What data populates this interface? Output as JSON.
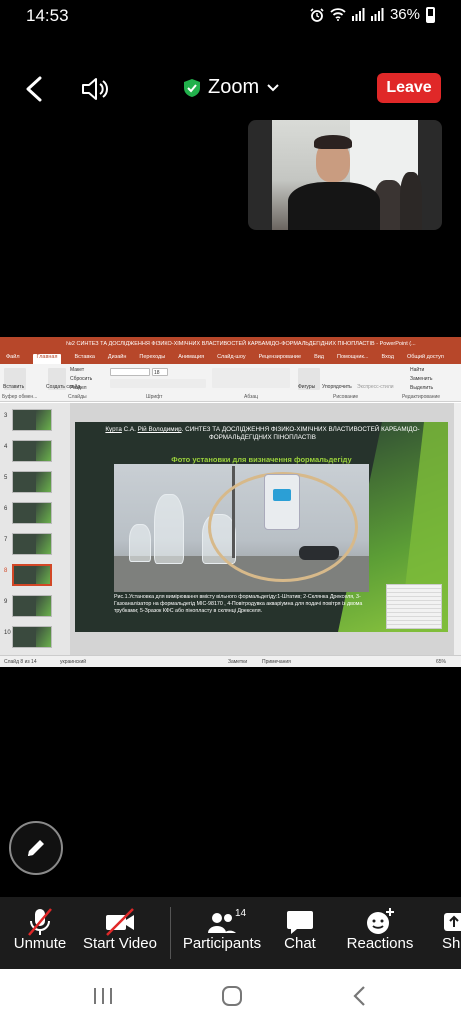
{
  "status_bar": {
    "time": "14:53",
    "battery": "36%"
  },
  "meeting": {
    "app_name": "Zoom",
    "leave_label": "Leave"
  },
  "shared_screen": {
    "window_title": "№2 СИНТЕЗ ТА ДОСЛІДЖЕННЯ ФІЗИКО-ХІМІЧНИХ ВЛАСТИВОСТЕЙ КАРБАМІДО-ФОРМАЛЬДЕГІДНИХ ПІНОПЛАСТІВ - PowerPoint (...",
    "ribbon_tabs": [
      "Файл",
      "Главная",
      "Вставка",
      "Дизайн",
      "Переходы",
      "Анимация",
      "Слайд-шоу",
      "Рецензирование",
      "Вид",
      "Помощник...",
      "Вход",
      "Общий доступ"
    ],
    "active_tab": "Главная",
    "ribbon_groups": [
      "Буфер обмен...",
      "Слайды",
      "Шрифт",
      "Абзац",
      "Рисование",
      "Редактирование"
    ],
    "ribbon_labels": {
      "paste": "Вставить",
      "new_slide": "Создать слайд",
      "layout": "Макет",
      "reset": "Сбросить",
      "section": "Раздел",
      "shapes": "Фигуры",
      "arrange": "Упорядочить",
      "quick_styles": "Экспресс-стили",
      "find": "Найти",
      "replace": "Заменить",
      "select": "Выделить",
      "font_size": "18"
    },
    "thumbnails": [
      {
        "num": "3"
      },
      {
        "num": "4"
      },
      {
        "num": "5"
      },
      {
        "num": "6"
      },
      {
        "num": "7"
      },
      {
        "num": "8"
      },
      {
        "num": "9"
      },
      {
        "num": "10"
      }
    ],
    "slide": {
      "authors_underlined": "Курта",
      "authors_mid": " С.А. ",
      "authors_underlined2": "Рій Володимир",
      "title": ". СИНТЕЗ ТА ДОСЛІДЖЕННЯ ФІЗИКО-ХІМІЧНИХ ВЛАСТИВОСТЕЙ КАРБАМІДО-ФОРМАЛЬДЕГІДНИХ ПІНОПЛАСТІВ",
      "subtitle": "Фото установки для визначення формальдегіду",
      "caption": "Рис.1.Установка для вимірювання вмісту вільного формальдегіду:1-Штатив; 2-Склянка Дрекселя, 3-Газоаналізатор на формальдегід МІС-98170 , 4-Повітродувка акваріумна для подачі повітря із двома трубками; 5-Зразок КФС або пінопласту в склянці Дрекселя."
    },
    "statusbar": {
      "slide_info": "Слайд 8 из 14",
      "language": "украинский",
      "notes": "Заметки",
      "comments": "Примечания",
      "zoom": "65%"
    }
  },
  "toolbar": {
    "unmute": "Unmute",
    "start_video": "Start Video",
    "participants": "Participants",
    "participants_count": "14",
    "chat": "Chat",
    "reactions": "Reactions",
    "share": "Sha"
  },
  "colors": {
    "leave": "#e02828",
    "shield": "#22b14c",
    "ppt": "#b7472a"
  }
}
